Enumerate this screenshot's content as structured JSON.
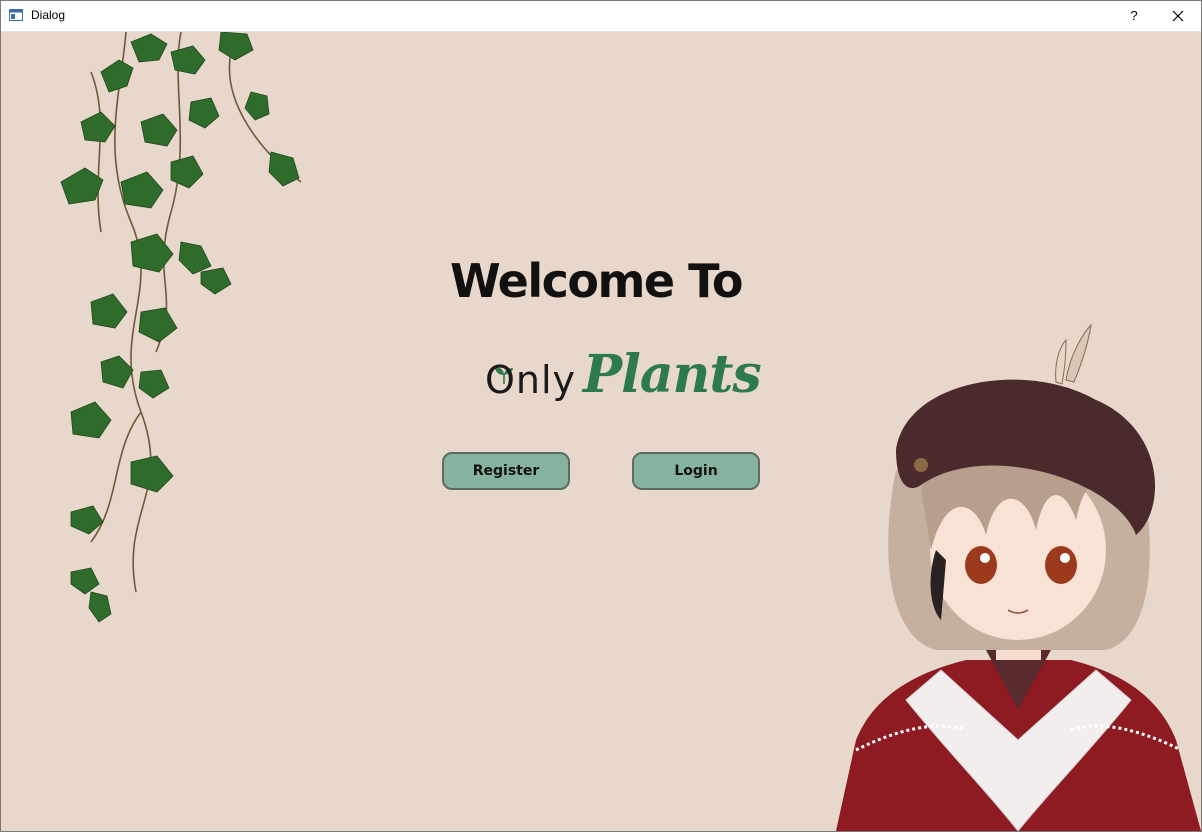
{
  "window": {
    "title": "Dialog",
    "help_label": "?",
    "icons": {
      "app": "dialog-app-icon",
      "close": "close-icon"
    }
  },
  "main": {
    "heading": "Welcome To",
    "logo": {
      "part1": "Only",
      "part2": "Plants"
    },
    "buttons": {
      "register": "Register",
      "login": "Login"
    }
  },
  "colors": {
    "background": "#e8d7cb",
    "button": "#86b3a0",
    "button_border": "#5b6b63",
    "logo_green": "#2d7a4e",
    "leaf_green": "#2f6b2a",
    "beret": "#4a2a2c",
    "coat": "#8e1a22"
  },
  "decorations": [
    "ivy-vine-illustration",
    "anime-girl-illustration"
  ]
}
